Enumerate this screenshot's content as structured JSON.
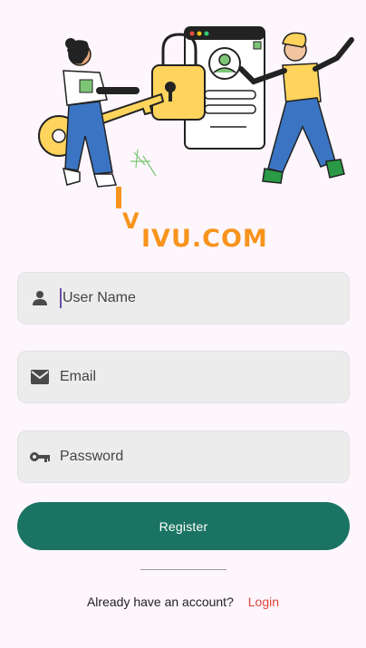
{
  "brand": {
    "logo_text": "IVU.COM",
    "logo_letter": "V"
  },
  "form": {
    "username": {
      "placeholder": "User Name",
      "icon": "person-icon"
    },
    "email": {
      "placeholder": "Email",
      "icon": "mail-icon"
    },
    "password": {
      "placeholder": "Password",
      "icon": "key-icon"
    },
    "register_label": "Register"
  },
  "footer": {
    "question": "Already have an account?",
    "login_label": "Login"
  },
  "colors": {
    "primary": "#1b7363",
    "link": "#e0463a",
    "background": "#fdf6fd",
    "logo_orange": "#f7941d",
    "field_bg": "#ececec"
  }
}
